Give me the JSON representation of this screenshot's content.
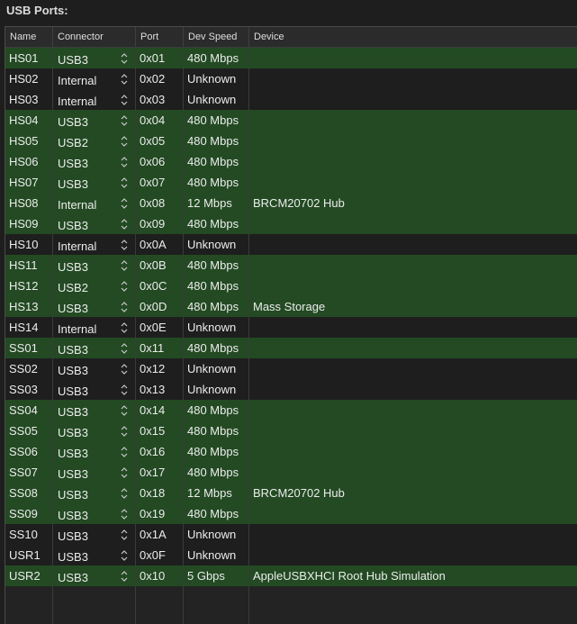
{
  "section_title": "USB Ports:",
  "columns": {
    "name": "Name",
    "connector": "Connector",
    "port": "Port",
    "speed": "Dev Speed",
    "device": "Device"
  },
  "colors": {
    "active_row": "#234a23",
    "inactive_row": "#1e1e1e"
  },
  "rows": [
    {
      "name": "HS01",
      "connector": "USB3",
      "port": "0x01",
      "speed": "480 Mbps",
      "device": "",
      "active": true
    },
    {
      "name": "HS02",
      "connector": "Internal",
      "port": "0x02",
      "speed": "Unknown",
      "device": "",
      "active": false
    },
    {
      "name": "HS03",
      "connector": "Internal",
      "port": "0x03",
      "speed": "Unknown",
      "device": "",
      "active": false
    },
    {
      "name": "HS04",
      "connector": "USB3",
      "port": "0x04",
      "speed": "480 Mbps",
      "device": "",
      "active": true
    },
    {
      "name": "HS05",
      "connector": "USB2",
      "port": "0x05",
      "speed": "480 Mbps",
      "device": "",
      "active": true
    },
    {
      "name": "HS06",
      "connector": "USB3",
      "port": "0x06",
      "speed": "480 Mbps",
      "device": "",
      "active": true
    },
    {
      "name": "HS07",
      "connector": "USB3",
      "port": "0x07",
      "speed": "480 Mbps",
      "device": "",
      "active": true
    },
    {
      "name": "HS08",
      "connector": "Internal",
      "port": "0x08",
      "speed": "12 Mbps",
      "device": "BRCM20702 Hub",
      "active": true
    },
    {
      "name": "HS09",
      "connector": "USB3",
      "port": "0x09",
      "speed": "480 Mbps",
      "device": "",
      "active": true
    },
    {
      "name": "HS10",
      "connector": "Internal",
      "port": "0x0A",
      "speed": "Unknown",
      "device": "",
      "active": false
    },
    {
      "name": "HS11",
      "connector": "USB3",
      "port": "0x0B",
      "speed": "480 Mbps",
      "device": "",
      "active": true
    },
    {
      "name": "HS12",
      "connector": "USB2",
      "port": "0x0C",
      "speed": "480 Mbps",
      "device": "",
      "active": true
    },
    {
      "name": "HS13",
      "connector": "USB3",
      "port": "0x0D",
      "speed": "480 Mbps",
      "device": "Mass Storage",
      "active": true
    },
    {
      "name": "HS14",
      "connector": "Internal",
      "port": "0x0E",
      "speed": "Unknown",
      "device": "",
      "active": false
    },
    {
      "name": "SS01",
      "connector": "USB3",
      "port": "0x11",
      "speed": "480 Mbps",
      "device": "",
      "active": true
    },
    {
      "name": "SS02",
      "connector": "USB3",
      "port": "0x12",
      "speed": "Unknown",
      "device": "",
      "active": false
    },
    {
      "name": "SS03",
      "connector": "USB3",
      "port": "0x13",
      "speed": "Unknown",
      "device": "",
      "active": false
    },
    {
      "name": "SS04",
      "connector": "USB3",
      "port": "0x14",
      "speed": "480 Mbps",
      "device": "",
      "active": true
    },
    {
      "name": "SS05",
      "connector": "USB3",
      "port": "0x15",
      "speed": "480 Mbps",
      "device": "",
      "active": true
    },
    {
      "name": "SS06",
      "connector": "USB3",
      "port": "0x16",
      "speed": "480 Mbps",
      "device": "",
      "active": true
    },
    {
      "name": "SS07",
      "connector": "USB3",
      "port": "0x17",
      "speed": "480 Mbps",
      "device": "",
      "active": true
    },
    {
      "name": "SS08",
      "connector": "USB3",
      "port": "0x18",
      "speed": "12 Mbps",
      "device": "BRCM20702 Hub",
      "active": true
    },
    {
      "name": "SS09",
      "connector": "USB3",
      "port": "0x19",
      "speed": "480 Mbps",
      "device": "",
      "active": true
    },
    {
      "name": "SS10",
      "connector": "USB3",
      "port": "0x1A",
      "speed": "Unknown",
      "device": "",
      "active": false
    },
    {
      "name": "USR1",
      "connector": "USB3",
      "port": "0x0F",
      "speed": "Unknown",
      "device": "",
      "active": false
    },
    {
      "name": "USR2",
      "connector": "USB3",
      "port": "0x10",
      "speed": "5 Gbps",
      "device": "AppleUSBXHCI Root Hub Simulation",
      "active": true
    }
  ]
}
